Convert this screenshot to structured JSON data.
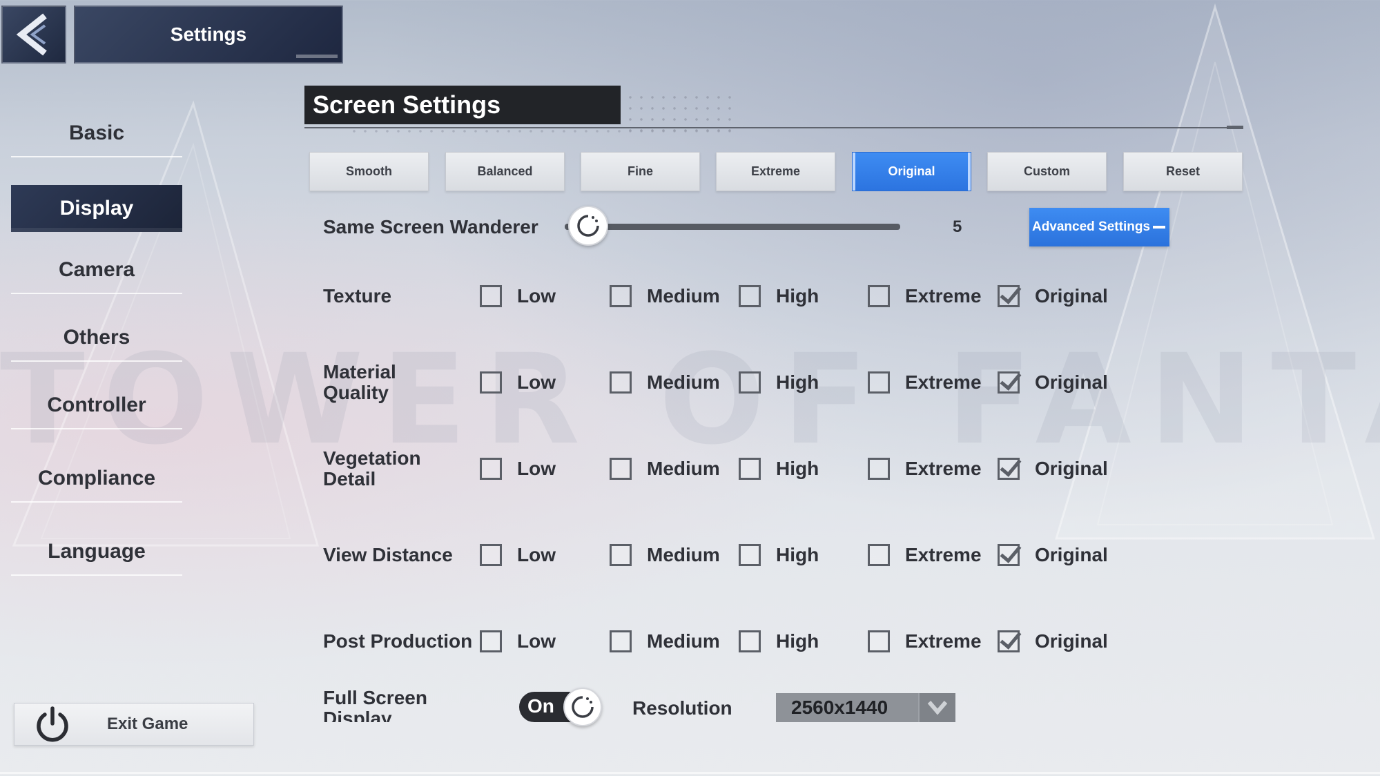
{
  "header": {
    "title": "Settings"
  },
  "sidebar": {
    "items": [
      {
        "label": "Basic",
        "active": false
      },
      {
        "label": "Display",
        "active": true
      },
      {
        "label": "Camera",
        "active": false
      },
      {
        "label": "Others",
        "active": false
      },
      {
        "label": "Controller",
        "active": false
      },
      {
        "label": "Compliance",
        "active": false
      },
      {
        "label": "Language",
        "active": false
      }
    ],
    "exit_label": "Exit Game"
  },
  "background": {
    "watermark": "TOWER OF FANTASY"
  },
  "section": {
    "title": "Screen Settings"
  },
  "presets": [
    {
      "label": "Smooth"
    },
    {
      "label": "Balanced"
    },
    {
      "label": "Fine"
    },
    {
      "label": "Extreme"
    },
    {
      "label": "Original"
    },
    {
      "label": "Custom"
    },
    {
      "label": "Reset"
    }
  ],
  "selected_preset": "Original",
  "wanderer": {
    "label": "Same Screen Wanderer",
    "value": "5",
    "slider_fraction": 0.05
  },
  "advanced": {
    "label": "Advanced Settings"
  },
  "quality_levels": [
    "Low",
    "Medium",
    "High",
    "Extreme",
    "Original"
  ],
  "options": [
    {
      "label_lines": [
        "Texture"
      ],
      "selected": "Original"
    },
    {
      "label_lines": [
        "Material",
        "Quality"
      ],
      "selected": "Original"
    },
    {
      "label_lines": [
        "Vegetation",
        "Detail"
      ],
      "selected": "Original"
    },
    {
      "label_lines": [
        "View Distance"
      ],
      "selected": "Original"
    },
    {
      "label_lines": [
        "Post Production"
      ],
      "selected": "Original"
    }
  ],
  "full_screen": {
    "label_lines": [
      "Full Screen",
      "Display"
    ],
    "toggle_label": "On",
    "enabled": true
  },
  "resolution": {
    "label": "Resolution",
    "value": "2560x1440"
  },
  "colors": {
    "accent": "#2f7ce6",
    "dark_panel": "#222428",
    "nav_active": "#263049"
  }
}
